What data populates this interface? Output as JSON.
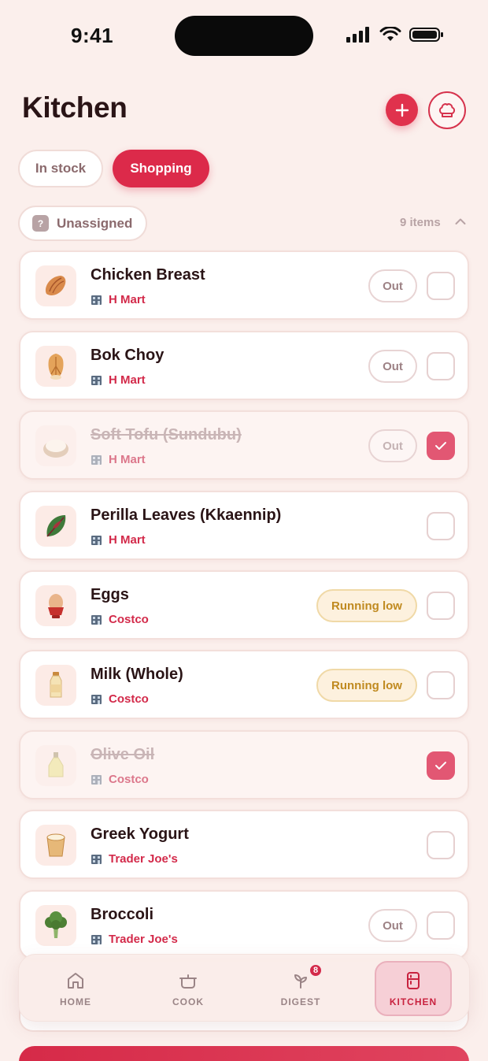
{
  "status_bar": {
    "time": "9:41"
  },
  "header": {
    "title": "Kitchen",
    "add_icon": "plus-icon",
    "chef_icon": "chef-hat-icon"
  },
  "tabs": [
    {
      "label": "In stock",
      "active": false
    },
    {
      "label": "Shopping",
      "active": true
    }
  ],
  "group": {
    "label": "Unassigned",
    "badge": "?",
    "count": "9 items"
  },
  "items": [
    {
      "name": "Chicken Breast",
      "store": "H Mart",
      "status": "Out",
      "checked": false
    },
    {
      "name": "Bok Choy",
      "store": "H Mart",
      "status": "Out",
      "checked": false
    },
    {
      "name": "Soft Tofu (Sundubu)",
      "store": "H Mart",
      "status": "Out",
      "checked": true
    },
    {
      "name": "Perilla Leaves (Kkaennip)",
      "store": "H Mart",
      "status": "",
      "checked": false
    },
    {
      "name": "Eggs",
      "store": "Costco",
      "status": "Running low",
      "checked": false
    },
    {
      "name": "Milk (Whole)",
      "store": "Costco",
      "status": "Running low",
      "checked": false
    },
    {
      "name": "Olive Oil",
      "store": "Costco",
      "status": "",
      "checked": true
    },
    {
      "name": "Greek Yogurt",
      "store": "Trader Joe's",
      "status": "",
      "checked": false
    },
    {
      "name": "Broccoli",
      "store": "Trader Joe's",
      "status": "Out",
      "checked": false
    }
  ],
  "nav": [
    {
      "label": "HOME",
      "icon": "home-icon"
    },
    {
      "label": "COOK",
      "icon": "pot-icon"
    },
    {
      "label": "DIGEST",
      "icon": "sprout-icon",
      "badge": "8"
    },
    {
      "label": "KITCHEN",
      "icon": "fridge-icon",
      "active": true
    }
  ],
  "colors": {
    "accent": "#dc2a4a",
    "background": "#fbefec",
    "warning": "#c08a20"
  }
}
